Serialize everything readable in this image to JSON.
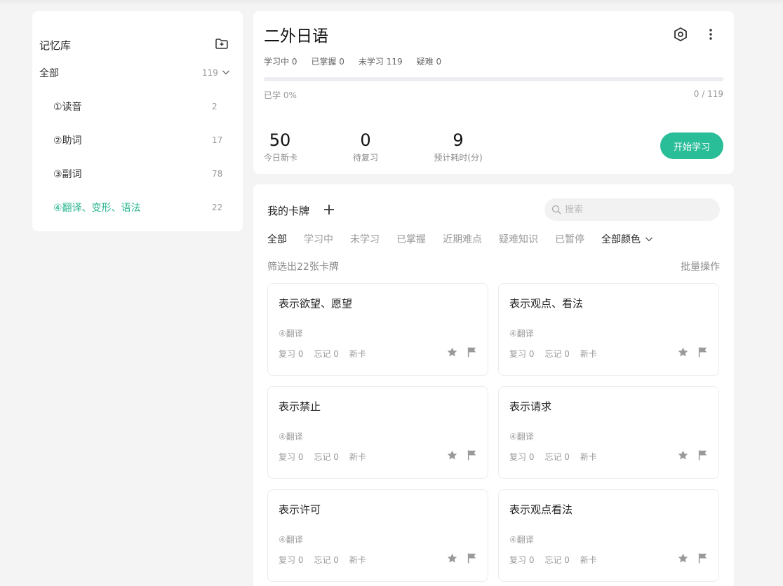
{
  "sidebar": {
    "title": "记忆库",
    "all": {
      "label": "全部",
      "count": "119"
    },
    "items": [
      {
        "label": "①读音",
        "count": "2"
      },
      {
        "label": "②助词",
        "count": "17"
      },
      {
        "label": "③副词",
        "count": "78"
      },
      {
        "label": "④翻译、变形、语法",
        "count": "22"
      }
    ]
  },
  "deck": {
    "title": "二外日语",
    "stats": {
      "learning": "学习中 0",
      "mastered": "已掌握 0",
      "unlearned": "未学习 119",
      "difficult": "疑难 0"
    },
    "progress_fraction": 0,
    "learned_label": "已学 0%",
    "ratio_label": "0 / 119",
    "metrics": [
      {
        "value": "50",
        "caption": "今日新卡"
      },
      {
        "value": "0",
        "caption": "待复习"
      },
      {
        "value": "9",
        "caption": "预计耗时(分)"
      }
    ],
    "start_label": "开始学习"
  },
  "cards_section": {
    "title": "我的卡牌",
    "search_placeholder": "搜索",
    "filters": [
      "全部",
      "学习中",
      "未学习",
      "已掌握",
      "近期难点",
      "疑难知识",
      "已暂停"
    ],
    "color_filter": "全部颜色",
    "count_text": "筛选出22张卡牌",
    "batch_label": "批量操作",
    "cards": [
      {
        "title": "表示欲望、愿望",
        "deck": "④翻译",
        "review": "复习 0",
        "forget": "忘记 0",
        "status": "新卡"
      },
      {
        "title": "表示观点、看法",
        "deck": "④翻译",
        "review": "复习 0",
        "forget": "忘记 0",
        "status": "新卡"
      },
      {
        "title": "表示禁止",
        "deck": "④翻译",
        "review": "复习 0",
        "forget": "忘记 0",
        "status": "新卡"
      },
      {
        "title": "表示请求",
        "deck": "④翻译",
        "review": "复习 0",
        "forget": "忘记 0",
        "status": "新卡"
      },
      {
        "title": "表示许可",
        "deck": "④翻译",
        "review": "复习 0",
        "forget": "忘记 0",
        "status": "新卡"
      },
      {
        "title": "表示观点看法",
        "deck": "④翻译",
        "review": "复习 0",
        "forget": "忘记 0",
        "status": "新卡"
      }
    ]
  },
  "colors": {
    "accent": "#28b58e",
    "button": "#29bd98",
    "icon": "#999999"
  }
}
